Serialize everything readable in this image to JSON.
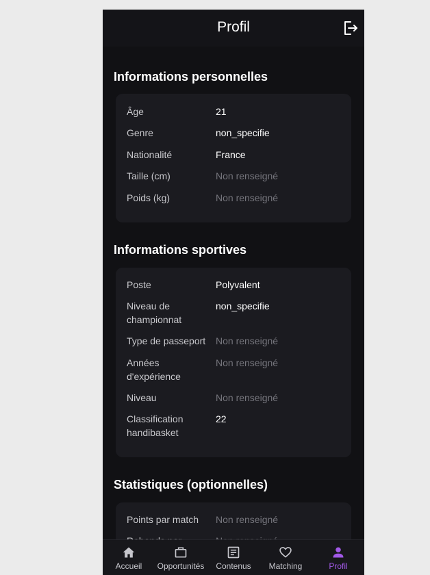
{
  "header": {
    "title": "Profil",
    "logout_icon": "logout-icon"
  },
  "personal": {
    "title": "Informations personnelles",
    "rows": [
      {
        "label": "Âge",
        "value": "21",
        "muted": false
      },
      {
        "label": "Genre",
        "value": "non_specifie",
        "muted": false
      },
      {
        "label": "Nationalité",
        "value": "France",
        "muted": false
      },
      {
        "label": "Taille (cm)",
        "value": "Non renseigné",
        "muted": true
      },
      {
        "label": "Poids (kg)",
        "value": "Non renseigné",
        "muted": true
      }
    ]
  },
  "sport": {
    "title": "Informations sportives",
    "rows": [
      {
        "label": "Poste",
        "value": "Polyvalent",
        "muted": false
      },
      {
        "label": "Niveau de championnat",
        "value": "non_specifie",
        "muted": false
      },
      {
        "label": "Type de passeport",
        "value": "Non renseigné",
        "muted": true
      },
      {
        "label": "Années d'expérience",
        "value": "Non renseigné",
        "muted": true
      },
      {
        "label": "Niveau",
        "value": "Non renseigné",
        "muted": true
      },
      {
        "label": "Classification handibasket",
        "value": "22",
        "muted": false
      }
    ]
  },
  "stats": {
    "title": "Statistiques (optionnelles)",
    "rows": [
      {
        "label": "Points par match",
        "value": "Non renseigné",
        "muted": true
      },
      {
        "label": "Rebonds par",
        "value": "Non renseigné",
        "muted": true
      }
    ]
  },
  "nav": {
    "items": [
      {
        "label": "Accueil",
        "icon": "home-icon",
        "active": false
      },
      {
        "label": "Opportunités",
        "icon": "briefcase-icon",
        "active": false
      },
      {
        "label": "Contenus",
        "icon": "article-icon",
        "active": false
      },
      {
        "label": "Matching",
        "icon": "heart-icon",
        "active": false
      },
      {
        "label": "Profil",
        "icon": "person-icon",
        "active": true
      }
    ]
  },
  "colors": {
    "accent": "#a259e8",
    "background": "#111114",
    "card": "#1b1b20",
    "muted_text": "#75757c"
  }
}
